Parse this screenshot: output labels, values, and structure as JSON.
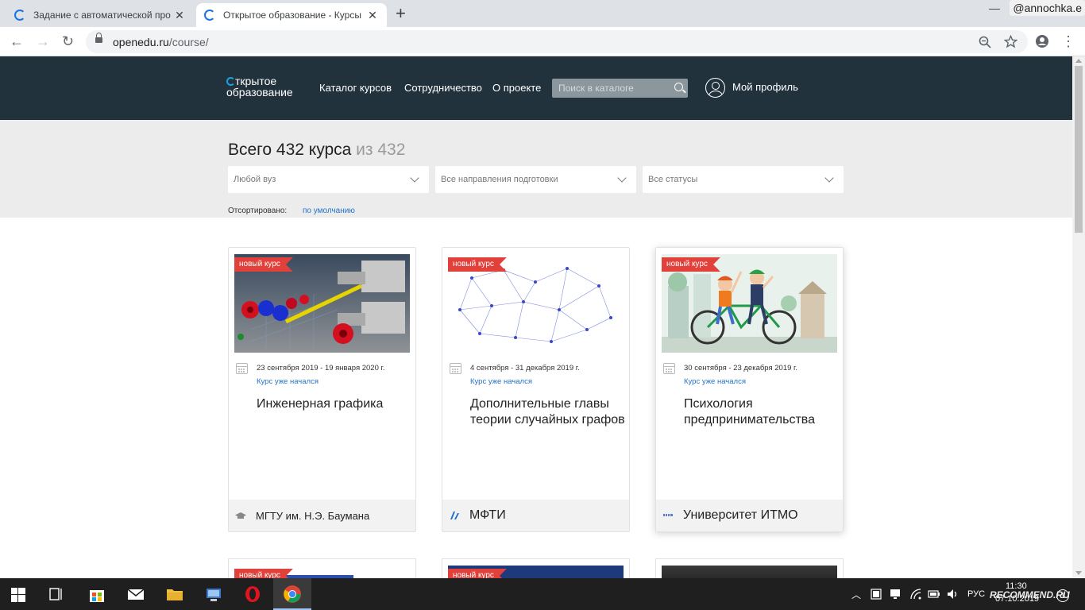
{
  "browser": {
    "tabs": [
      {
        "title": "Задание с автоматической про",
        "close": "✕",
        "active": false
      },
      {
        "title": "Открытое образование - Курсы",
        "close": "✕",
        "active": true
      }
    ],
    "new_tab": "+",
    "window_minimize": "—",
    "watermark": "@annochka.e",
    "url_domain": "openedu.ru",
    "url_path": "/course/",
    "nav": {
      "back": "←",
      "forward": "→",
      "reload": "↻"
    },
    "icons": {
      "zoom": "zoom-icon",
      "star": "star-icon",
      "account": "account-icon",
      "menu": "⋮"
    }
  },
  "site": {
    "logo_line1": "ткрытое",
    "logo_line2": "образование",
    "nav": [
      "Каталог курсов",
      "Сотрудничество",
      "О проекте"
    ],
    "search_placeholder": "Поиск в каталоге",
    "profile_label": "Мой профиль"
  },
  "filters": {
    "total_text": "Всего 432 курса",
    "total_of": "из 432",
    "selects": [
      "Любой вуз",
      "Все направления подготовки",
      "Все статусы"
    ],
    "sort_label": "Отсортировано:",
    "sort_value": "по умолчанию"
  },
  "courses": [
    {
      "badge": "новый курс",
      "dates": "23 сентября 2019 - 19 января 2020 г.",
      "status": "Курс уже начался",
      "title": "Инженерная графика",
      "university": "МГТУ им. Н.Э. Баумана"
    },
    {
      "badge": "новый курс",
      "dates": "4 сентября - 31 декабря 2019 г.",
      "status": "Курс уже начался",
      "title": "Дополнительные главы теории случайных графов",
      "university": "МФТИ"
    },
    {
      "badge": "новый курс",
      "dates": "30 сентября - 23 декабря 2019 г.",
      "status": "Курс уже начался",
      "title": "Психология предпринимательства",
      "university": "Университет ИТМО"
    }
  ],
  "next_row_badges": [
    "новый курс",
    "новый курс"
  ],
  "taskbar": {
    "time": "11:30",
    "date": "07.10.2019",
    "lang": "РУС",
    "notification_count": "1",
    "watermark": "RECOMMEND.RU"
  },
  "colors": {
    "header_bg": "#22323d",
    "badge": "#e2413b",
    "link": "#2473c6",
    "filter_bg": "#ececec"
  }
}
